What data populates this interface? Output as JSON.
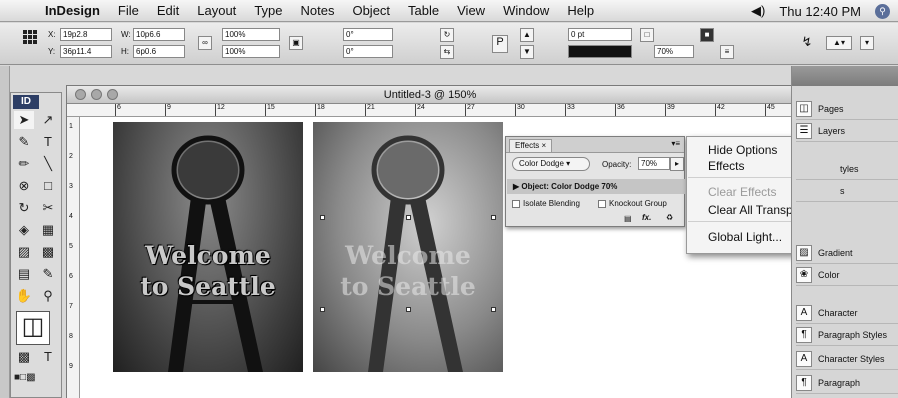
{
  "menubar": {
    "apple": "",
    "app": "InDesign",
    "items": [
      "File",
      "Edit",
      "Layout",
      "Type",
      "Notes",
      "Object",
      "Table",
      "View",
      "Window",
      "Help"
    ],
    "volume": "◀)",
    "clock": "Thu 12:40 PM"
  },
  "control": {
    "x_label": "X:",
    "x": "19p2.8",
    "y_label": "Y:",
    "y": "36p11.4",
    "w_label": "W:",
    "w": "10p6.6",
    "h_label": "H:",
    "h": "6p0.6",
    "scale_x": "100%",
    "scale_y": "100%",
    "rot": "0°",
    "shear": "0°",
    "stroke": "0 pt",
    "zoom": "70%"
  },
  "tools": {
    "badge": "ID"
  },
  "doc": {
    "title": "Untitled-3 @ 150%",
    "ruler": [
      "6",
      "9",
      "12",
      "15",
      "18",
      "21",
      "24",
      "27",
      "30",
      "33",
      "36",
      "39",
      "42",
      "45"
    ],
    "vruler": [
      "1",
      "2",
      "3",
      "4",
      "5",
      "6",
      "7",
      "8",
      "9"
    ]
  },
  "photo": {
    "line1": "Welcome",
    "line2": "to Seattle"
  },
  "effects": {
    "tab": "Effects",
    "mode": "Color Dodge",
    "opacity_label": "Opacity:",
    "opacity": "70%",
    "object": "Object: Color Dodge 70%",
    "isolate": "Isolate Blending",
    "knockout": "Knockout Group",
    "fx": "fx."
  },
  "menu": {
    "hide": "Hide Options",
    "effects": "Effects",
    "clear": "Clear Effects",
    "clear_all": "Clear All Transparency",
    "global": "Global Light..."
  },
  "panels": {
    "pages": "Pages",
    "layers": "Layers",
    "styles_frag": "tyles",
    "s_frag": "s",
    "gradient": "Gradient",
    "color": "Color",
    "character": "Character",
    "para_styles": "Paragraph Styles",
    "char_styles": "Character Styles",
    "paragraph": "Paragraph"
  },
  "colors": {
    "accent": "#2d3e65"
  }
}
